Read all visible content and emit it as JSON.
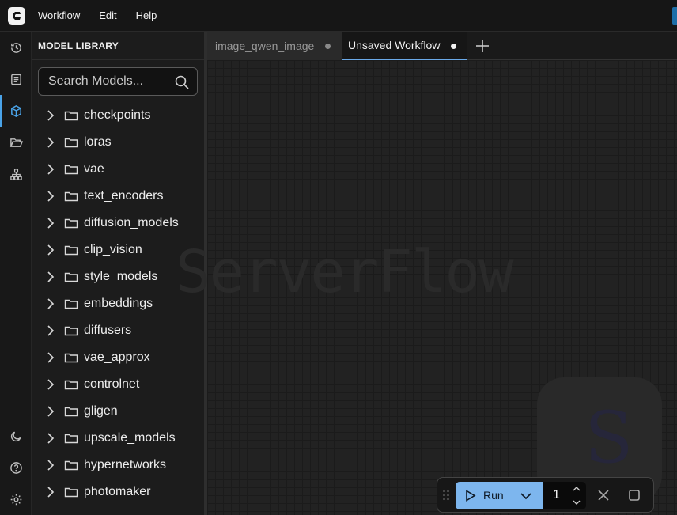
{
  "menubar": {
    "logo": "comfy-logo-icon",
    "items": [
      "Workflow",
      "Edit",
      "Help"
    ]
  },
  "rail": {
    "top": [
      "history-icon",
      "queue-icon",
      "model-library-icon",
      "workflows-icon",
      "node-library-icon"
    ],
    "active": "model-library-icon",
    "bottom": [
      "theme-toggle-icon",
      "help-icon",
      "settings-icon"
    ]
  },
  "sidebar": {
    "title": "MODEL LIBRARY",
    "search": {
      "placeholder": "Search Models...",
      "value": ""
    },
    "folders": [
      "checkpoints",
      "loras",
      "vae",
      "text_encoders",
      "diffusion_models",
      "clip_vision",
      "style_models",
      "embeddings",
      "diffusers",
      "vae_approx",
      "controlnet",
      "gligen",
      "upscale_models",
      "hypernetworks",
      "photomaker"
    ]
  },
  "tabs": [
    {
      "label": "image_qwen_image",
      "active": false,
      "unsaved": true
    },
    {
      "label": "Unsaved Workflow",
      "active": true,
      "unsaved": true
    }
  ],
  "canvas": {
    "watermark": "ServerFlow",
    "watermark_logo_letter": "S"
  },
  "runbar": {
    "run_label": "Run",
    "batch_count": "1"
  },
  "colors": {
    "accent": "#7db6ee",
    "active_indicator": "#4aa3e8",
    "background": "#202020"
  }
}
